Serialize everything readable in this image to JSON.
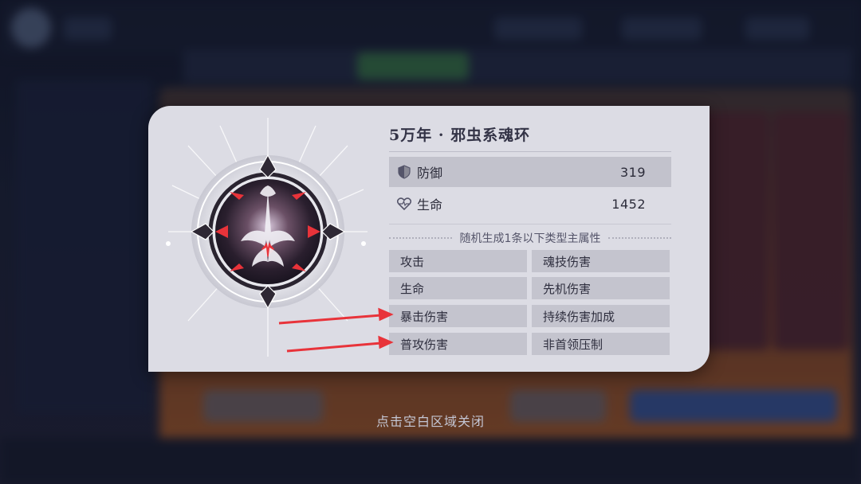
{
  "ring": {
    "title": "5万年 · 邪虫系魂环",
    "stats": [
      {
        "icon": "shield-icon",
        "label": "防御",
        "value": "319"
      },
      {
        "icon": "heart-icon",
        "label": "生命",
        "value": "1452"
      }
    ],
    "random_header": "随机生成1条以下类型主属性",
    "attributes": [
      "攻击",
      "魂技伤害",
      "生命",
      "先机伤害",
      "暴击伤害",
      "持续伤害加成",
      "普攻伤害",
      "非首领压制"
    ],
    "highlighted": [
      "暴击伤害",
      "普攻伤害"
    ]
  },
  "close_hint": "点击空白区域关闭",
  "colors": {
    "arrow": "#e8333a",
    "dialog_bg": "#dcdce4",
    "row_bg": "#c4c4ce"
  }
}
